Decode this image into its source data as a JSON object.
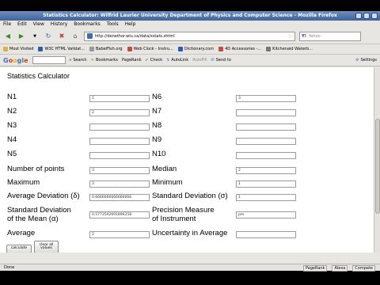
{
  "window": {
    "title": "Statistics Calculator: Wilfrid Laurier University Department of Physics and Computer Science - Mozilla Firefox"
  },
  "menu": [
    "File",
    "Edit",
    "View",
    "History",
    "Bookmarks",
    "Tools",
    "Help"
  ],
  "nav": {
    "url": "http://denethor.wlu.ca/data/xstats.shtml",
    "search_placeholder": "Yahoo",
    "search_engine": "Y!"
  },
  "bookmarks": [
    "Most Visited",
    "W3C HTML Validat...",
    "BabelFish.org",
    "Web Clock - Instru...",
    "Dictionary.com",
    "4D Accessories -...",
    "Kitchenaid Waterb..."
  ],
  "google_toolbar": {
    "logo": "Google",
    "items": [
      "Search",
      "Bookmarks",
      "PageRank",
      "Check",
      "AutoLink",
      "AutoFill",
      "Send to"
    ],
    "settings": "Settings"
  },
  "page": {
    "heading": "Statistics Calculator",
    "left_labels": [
      "N1",
      "N2",
      "N3",
      "N4",
      "N5"
    ],
    "right_labels": [
      "N6",
      "N7",
      "N8",
      "N9",
      "N10"
    ],
    "left_values": [
      "1",
      "2",
      "",
      "",
      ""
    ],
    "right_values": [
      "3",
      "",
      "",
      "",
      ""
    ],
    "number_of_points": {
      "label": "Number of points",
      "value": "3"
    },
    "median": {
      "label": "Median",
      "value": "2"
    },
    "maximum": {
      "label": "Maximum",
      "value": "3"
    },
    "minimum": {
      "label": "Minimum",
      "value": "1"
    },
    "average_deviation": {
      "label": "Average Deviation (δ)",
      "value": "0.6666666666666666"
    },
    "standard_deviation": {
      "label": "Standard Deviation (σ)",
      "value": "1"
    },
    "sd_mean": {
      "label_line1": "Standard Deviation",
      "label_line2": "of the Mean (α)",
      "value": "0.5773502691896258"
    },
    "precision": {
      "label_line1": "Precision Measure",
      "label_line2": "of Instrument",
      "value": "pm"
    },
    "average": {
      "label": "Average",
      "value": "2"
    },
    "uncertainty": {
      "label": "Uncertainty in Average",
      "value": ""
    },
    "calculate_label": "calculate",
    "clear_label_line1": "clear all",
    "clear_label_line2": "values"
  },
  "status": {
    "text": "Done",
    "pagerank": "PageRank",
    "alexa": "Alexa",
    "compete": "Compete"
  }
}
